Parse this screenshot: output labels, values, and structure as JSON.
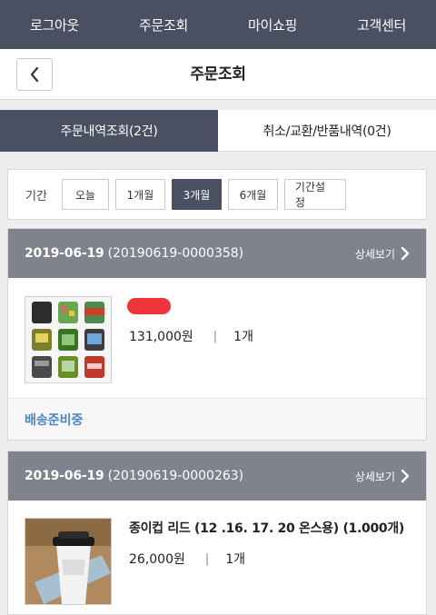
{
  "topnav": {
    "items": [
      {
        "label": "로그아웃"
      },
      {
        "label": "주문조회"
      },
      {
        "label": "마이쇼핑"
      },
      {
        "label": "고객센터"
      }
    ]
  },
  "header": {
    "back_icon": "chevron-left-icon",
    "title": "주문조회"
  },
  "tabs": [
    {
      "label": "주문내역조회(2건)",
      "active": true
    },
    {
      "label": "취소/교환/반품내역(0건)",
      "active": false
    }
  ],
  "period": {
    "label": "기간",
    "buttons": [
      {
        "label": "오늘",
        "selected": false
      },
      {
        "label": "1개월",
        "selected": false
      },
      {
        "label": "3개월",
        "selected": true
      },
      {
        "label": "6개월",
        "selected": false
      },
      {
        "label": "기간설정",
        "selected": false
      }
    ]
  },
  "orders": [
    {
      "date": "2019-06-19",
      "order_no": "(20190619-0000358)",
      "detail_label": "상세보기",
      "product_name": "",
      "price": "131,000원",
      "quantity": "1개",
      "status": "배송준비중"
    },
    {
      "date": "2019-06-19",
      "order_no": "(20190619-0000263)",
      "detail_label": "상세보기",
      "product_name": "종이컵 리드 (12 .16. 17. 20 온스용) (1.000개)",
      "price": "26,000원",
      "quantity": "1개"
    }
  ],
  "colors": {
    "nav_bg": "#4a5062",
    "order_head_bg": "#80838d",
    "status_text": "#4a86c5",
    "redaction": "#f0343a"
  }
}
